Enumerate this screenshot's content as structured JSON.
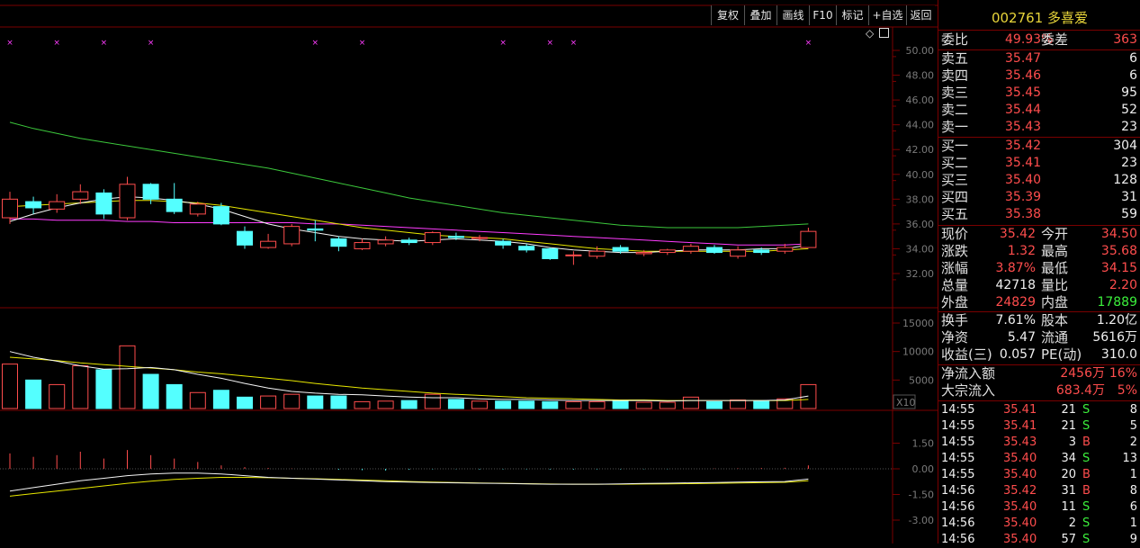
{
  "toolbar": {
    "buttons": [
      {
        "label": "复权",
        "name": "fuquan-button"
      },
      {
        "label": "叠加",
        "name": "overlay-button"
      },
      {
        "label": "画线",
        "name": "draw-line-button"
      },
      {
        "label": "F10",
        "name": "f10-button"
      },
      {
        "label": "标记",
        "name": "mark-button"
      },
      {
        "label": "+自选",
        "name": "add-watchlist-button"
      },
      {
        "label": "返回",
        "name": "back-button"
      }
    ]
  },
  "chart_icons": {
    "diamond": "◇",
    "window": "🗖"
  },
  "price_axis": {
    "ticks": [
      "50.00",
      "48.00",
      "46.00",
      "44.00",
      "42.00",
      "40.00",
      "38.00",
      "36.00",
      "34.00",
      "32.00"
    ]
  },
  "volume_axis": {
    "ticks": [
      "15000",
      "10000",
      "5000"
    ],
    "multiplier": "X10"
  },
  "macd_axis": {
    "ticks": [
      "1.50",
      "0.00",
      "-1.50",
      "-3.00"
    ]
  },
  "colors": {
    "up": "#ff4d4d",
    "down": "#54ffff",
    "ma5": "#f5f5f5",
    "ma10": "#e8e800",
    "ma20": "#ff3cff",
    "ma60": "#3cc83c",
    "border": "#7a0000",
    "label": "#e0e0e0",
    "title": "#e8d53a"
  },
  "stock": {
    "code": "002761",
    "name": "多喜爱"
  },
  "order_ratio": {
    "label1": "委比",
    "value1": "49.93%",
    "label2": "委差",
    "value2": "363"
  },
  "asks": [
    {
      "label": "卖五",
      "price": "35.47",
      "vol": "6"
    },
    {
      "label": "卖四",
      "price": "35.46",
      "vol": "6"
    },
    {
      "label": "卖三",
      "price": "35.45",
      "vol": "95"
    },
    {
      "label": "卖二",
      "price": "35.44",
      "vol": "52"
    },
    {
      "label": "卖一",
      "price": "35.43",
      "vol": "23"
    }
  ],
  "bids": [
    {
      "label": "买一",
      "price": "35.42",
      "vol": "304"
    },
    {
      "label": "买二",
      "price": "35.41",
      "vol": "23"
    },
    {
      "label": "买三",
      "price": "35.40",
      "vol": "128"
    },
    {
      "label": "买四",
      "price": "35.39",
      "vol": "31"
    },
    {
      "label": "买五",
      "price": "35.38",
      "vol": "59"
    }
  ],
  "quote": [
    {
      "l1": "现价",
      "v1": "35.42",
      "c1": "red",
      "l2": "今开",
      "v2": "34.50",
      "c2": "red"
    },
    {
      "l1": "涨跌",
      "v1": "1.32",
      "c1": "red",
      "l2": "最高",
      "v2": "35.68",
      "c2": "red"
    },
    {
      "l1": "涨幅",
      "v1": "3.87%",
      "c1": "red",
      "l2": "最低",
      "v2": "34.15",
      "c2": "red"
    },
    {
      "l1": "总量",
      "v1": "42718",
      "c1": "white",
      "l2": "量比",
      "v2": "2.20",
      "c2": "red"
    },
    {
      "l1": "外盘",
      "v1": "24829",
      "c1": "red",
      "l2": "内盘",
      "v2": "17889",
      "c2": "green"
    }
  ],
  "stats": [
    {
      "l1": "换手",
      "v1": "7.61%",
      "l2": "股本",
      "v2": "1.20亿"
    },
    {
      "l1": "净资",
      "v1": "5.47",
      "l2": "流通",
      "v2": "5616万"
    },
    {
      "l1": "收益(三)",
      "v1": "0.057",
      "l2": "PE(动)",
      "v2": "310.0"
    }
  ],
  "flows": [
    {
      "label": "净流入额",
      "value": "2456万",
      "pct": "16%"
    },
    {
      "label": "大宗流入",
      "value": "683.4万",
      "pct": "5%"
    }
  ],
  "trades": [
    {
      "time": "14:55",
      "price": "35.41",
      "vol": "21",
      "side": "S",
      "num": "8"
    },
    {
      "time": "14:55",
      "price": "35.41",
      "vol": "21",
      "side": "S",
      "num": "5"
    },
    {
      "time": "14:55",
      "price": "35.43",
      "vol": "3",
      "side": "B",
      "num": "2"
    },
    {
      "time": "14:55",
      "price": "35.40",
      "vol": "34",
      "side": "S",
      "num": "13"
    },
    {
      "time": "14:55",
      "price": "35.40",
      "vol": "20",
      "side": "B",
      "num": "1"
    },
    {
      "time": "14:56",
      "price": "35.42",
      "vol": "31",
      "side": "B",
      "num": "8"
    },
    {
      "time": "14:56",
      "price": "35.40",
      "vol": "11",
      "side": "S",
      "num": "6"
    },
    {
      "time": "14:56",
      "price": "35.40",
      "vol": "2",
      "side": "S",
      "num": "1"
    },
    {
      "time": "14:56",
      "price": "35.40",
      "vol": "57",
      "side": "S",
      "num": "9"
    }
  ],
  "chart_data": [
    {
      "type": "candlestick",
      "ylim": [
        31,
        51
      ],
      "candles": [
        {
          "o": 36.5,
          "c": 38.0,
          "h": 38.6,
          "l": 36.0
        },
        {
          "o": 37.8,
          "c": 37.3,
          "h": 38.2,
          "l": 36.8
        },
        {
          "o": 37.2,
          "c": 37.8,
          "h": 38.4,
          "l": 36.9
        },
        {
          "o": 38.0,
          "c": 38.6,
          "h": 39.2,
          "l": 37.6
        },
        {
          "o": 38.5,
          "c": 36.8,
          "h": 38.8,
          "l": 36.4
        },
        {
          "o": 36.5,
          "c": 39.2,
          "h": 39.8,
          "l": 36.3
        },
        {
          "o": 39.2,
          "c": 38.0,
          "h": 39.3,
          "l": 37.6
        },
        {
          "o": 38.0,
          "c": 37.0,
          "h": 39.3,
          "l": 36.8
        },
        {
          "o": 36.8,
          "c": 37.6,
          "h": 37.8,
          "l": 36.6
        },
        {
          "o": 37.4,
          "c": 36.0,
          "h": 37.7,
          "l": 35.9
        },
        {
          "o": 35.4,
          "c": 34.3,
          "h": 35.8,
          "l": 34.0
        },
        {
          "o": 34.1,
          "c": 34.6,
          "h": 35.2,
          "l": 34.0
        },
        {
          "o": 34.4,
          "c": 35.8,
          "h": 36.0,
          "l": 34.2
        },
        {
          "o": 35.6,
          "c": 35.5,
          "h": 36.3,
          "l": 34.6
        },
        {
          "o": 34.8,
          "c": 34.2,
          "h": 35.0,
          "l": 33.8
        },
        {
          "o": 34.0,
          "c": 34.5,
          "h": 34.8,
          "l": 33.9
        },
        {
          "o": 34.4,
          "c": 34.7,
          "h": 35.0,
          "l": 34.2
        },
        {
          "o": 34.7,
          "c": 34.5,
          "h": 34.9,
          "l": 34.3
        },
        {
          "o": 34.5,
          "c": 35.3,
          "h": 35.4,
          "l": 34.3
        },
        {
          "o": 35.0,
          "c": 34.9,
          "h": 35.3,
          "l": 34.7
        },
        {
          "o": 34.9,
          "c": 34.9,
          "h": 35.1,
          "l": 34.6
        },
        {
          "o": 34.6,
          "c": 34.3,
          "h": 34.8,
          "l": 34.0
        },
        {
          "o": 34.2,
          "c": 33.9,
          "h": 34.4,
          "l": 33.7
        },
        {
          "o": 34.0,
          "c": 33.2,
          "h": 34.1,
          "l": 33.1
        },
        {
          "o": 33.5,
          "c": 33.5,
          "h": 33.8,
          "l": 32.7
        },
        {
          "o": 33.4,
          "c": 33.8,
          "h": 34.2,
          "l": 33.2
        },
        {
          "o": 34.1,
          "c": 33.8,
          "h": 34.3,
          "l": 33.6
        },
        {
          "o": 33.6,
          "c": 33.7,
          "h": 33.9,
          "l": 33.4
        },
        {
          "o": 33.7,
          "c": 33.9,
          "h": 34.0,
          "l": 33.5
        },
        {
          "o": 33.8,
          "c": 34.2,
          "h": 34.4,
          "l": 33.6
        },
        {
          "o": 34.1,
          "c": 33.7,
          "h": 34.3,
          "l": 33.6
        },
        {
          "o": 33.4,
          "c": 33.9,
          "h": 34.2,
          "l": 33.2
        },
        {
          "o": 33.9,
          "c": 33.7,
          "h": 34.1,
          "l": 33.5
        },
        {
          "o": 33.8,
          "c": 34.1,
          "h": 34.4,
          "l": 33.6
        },
        {
          "o": 34.1,
          "c": 35.4,
          "h": 35.7,
          "l": 34.1
        }
      ],
      "ma5": [
        36.2,
        36.8,
        37.3,
        37.7,
        38.0,
        38.2,
        38.1,
        37.9,
        37.6,
        37.2,
        36.6,
        36.0,
        35.6,
        35.3,
        35.0,
        34.8,
        34.7,
        34.6,
        34.7,
        34.8,
        34.7,
        34.6,
        34.4,
        34.1,
        33.9,
        33.8,
        33.7,
        33.7,
        33.8,
        33.9,
        33.9,
        33.9,
        34.0,
        34.0,
        34.3
      ],
      "ma10": [
        37.4,
        37.5,
        37.6,
        37.7,
        37.8,
        37.9,
        37.9,
        37.8,
        37.7,
        37.5,
        37.2,
        36.9,
        36.6,
        36.3,
        36.0,
        35.7,
        35.5,
        35.3,
        35.1,
        35.0,
        34.9,
        34.8,
        34.6,
        34.4,
        34.2,
        34.0,
        33.9,
        33.8,
        33.8,
        33.8,
        33.8,
        33.8,
        33.8,
        33.9,
        34.0
      ],
      "ma20": [
        36.4,
        36.4,
        36.3,
        36.3,
        36.3,
        36.2,
        36.2,
        36.1,
        36.1,
        36.1,
        36.1,
        36.1,
        36.1,
        36.0,
        36.0,
        35.9,
        35.8,
        35.7,
        35.6,
        35.5,
        35.4,
        35.3,
        35.2,
        35.1,
        35.0,
        34.9,
        34.8,
        34.7,
        34.6,
        34.5,
        34.4,
        34.3,
        34.3,
        34.3,
        34.4
      ],
      "ma60": [
        44.2,
        43.7,
        43.3,
        42.9,
        42.6,
        42.3,
        42.0,
        41.7,
        41.4,
        41.1,
        40.8,
        40.5,
        40.1,
        39.7,
        39.3,
        38.9,
        38.5,
        38.1,
        37.8,
        37.5,
        37.2,
        36.9,
        36.7,
        36.5,
        36.3,
        36.1,
        35.9,
        35.8,
        35.7,
        35.7,
        35.7,
        35.7,
        35.8,
        35.9,
        36.0
      ],
      "markers": [
        0,
        2,
        4,
        6,
        13,
        15,
        21,
        23,
        24,
        34
      ]
    },
    {
      "type": "bar",
      "ylim": [
        0,
        16000
      ],
      "volumes": [
        7800,
        5000,
        4200,
        7500,
        6800,
        11000,
        6000,
        4200,
        2800,
        3200,
        2000,
        2200,
        2500,
        2200,
        2200,
        1200,
        1300,
        1400,
        2500,
        1600,
        1300,
        1300,
        1300,
        1200,
        1200,
        1200,
        1400,
        1100,
        1100,
        2000,
        1200,
        1500,
        1400,
        1700,
        4200
      ],
      "vol_ma5": [
        10000,
        9000,
        8300,
        7500,
        6900,
        7000,
        7200,
        6800,
        6000,
        5300,
        4400,
        3600,
        3000,
        2700,
        2500,
        2400,
        2200,
        2000,
        1900,
        1900,
        1700,
        1600,
        1600,
        1500,
        1400,
        1400,
        1400,
        1400,
        1300,
        1400,
        1400,
        1400,
        1400,
        1500,
        2200
      ],
      "vol_ma10": [
        9000,
        8700,
        8400,
        8000,
        7700,
        7400,
        7100,
        6800,
        6400,
        6100,
        5700,
        5300,
        4900,
        4400,
        4000,
        3600,
        3300,
        3000,
        2700,
        2500,
        2300,
        2100,
        1900,
        1800,
        1700,
        1600,
        1500,
        1500,
        1400,
        1400,
        1400,
        1400,
        1400,
        1400,
        1600
      ]
    },
    {
      "type": "bar",
      "ylim": [
        -3.5,
        2.5
      ],
      "macd": [
        0.9,
        0.7,
        0.8,
        1.0,
        0.6,
        1.1,
        0.8,
        0.6,
        0.4,
        0.2,
        0.1,
        0.05,
        0.02,
        0.0,
        -0.05,
        -0.08,
        -0.1,
        -0.05,
        -0.03,
        -0.02,
        -0.04,
        -0.03,
        -0.03,
        -0.04,
        -0.04,
        -0.03,
        -0.03,
        -0.02,
        -0.02,
        0.0,
        0.02,
        0.03,
        0.05,
        0.06,
        0.2
      ],
      "dif": [
        -1.3,
        -1.1,
        -0.9,
        -0.7,
        -0.55,
        -0.4,
        -0.3,
        -0.25,
        -0.25,
        -0.3,
        -0.4,
        -0.5,
        -0.55,
        -0.6,
        -0.65,
        -0.7,
        -0.75,
        -0.78,
        -0.8,
        -0.82,
        -0.84,
        -0.86,
        -0.88,
        -0.9,
        -0.9,
        -0.9,
        -0.88,
        -0.86,
        -0.84,
        -0.82,
        -0.8,
        -0.78,
        -0.76,
        -0.74,
        -0.6
      ],
      "dea": [
        -1.6,
        -1.45,
        -1.3,
        -1.15,
        -1.0,
        -0.85,
        -0.72,
        -0.62,
        -0.55,
        -0.5,
        -0.5,
        -0.52,
        -0.55,
        -0.58,
        -0.62,
        -0.66,
        -0.7,
        -0.74,
        -0.78,
        -0.8,
        -0.83,
        -0.85,
        -0.87,
        -0.89,
        -0.9,
        -0.9,
        -0.9,
        -0.89,
        -0.88,
        -0.87,
        -0.85,
        -0.83,
        -0.81,
        -0.79,
        -0.7
      ]
    }
  ]
}
